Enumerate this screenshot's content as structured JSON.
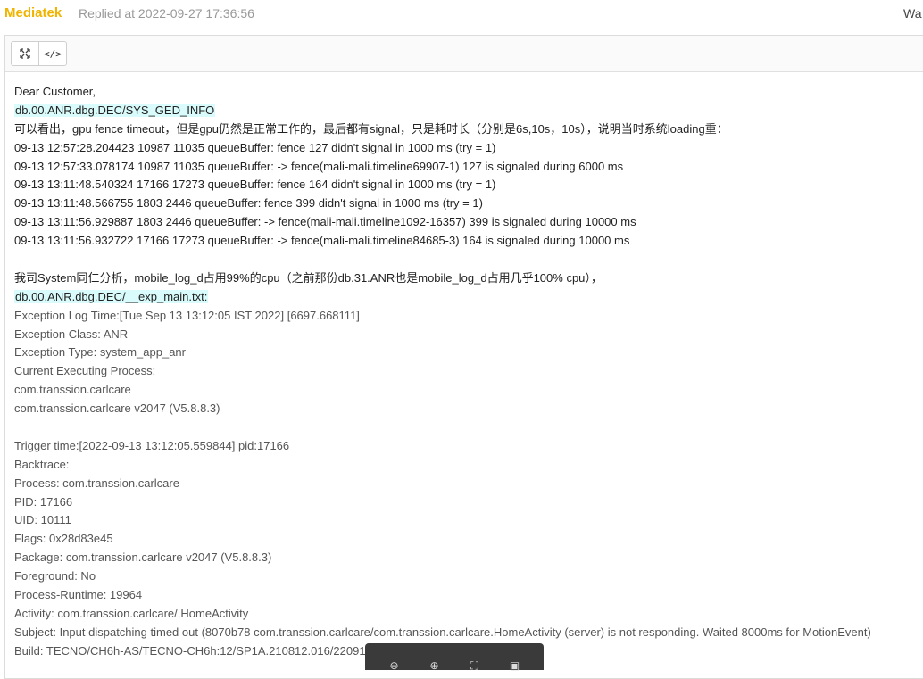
{
  "header": {
    "author": "Mediatek",
    "replied": "Replied at 2022-09-27 17:36:56",
    "right_text": "Wa"
  },
  "toolbar": {
    "fullscreen_icon": "fullscreen-icon",
    "code_label": "</>"
  },
  "lines": [
    {
      "text": "Dear Customer,",
      "hl": false,
      "gray": false
    },
    {
      "text": "db.00.ANR.dbg.DEC/SYS_GED_INFO",
      "hl": true,
      "gray": false
    },
    {
      "text": "可以看出，gpu fence timeout，但是gpu仍然是正常工作的，最后都有signal，只是耗时长（分别是6s,10s，10s），说明当时系统loading重：",
      "hl": false,
      "gray": false
    },
    {
      "text": "09-13 12:57:28.204423 10987 11035 queueBuffer: fence 127 didn't signal in 1000 ms (try = 1)",
      "hl": false,
      "gray": false
    },
    {
      "text": "09-13 12:57:33.078174 10987 11035 queueBuffer: -> fence(mali-mali.timeline69907-1) 127 is signaled during 6000 ms",
      "hl": false,
      "gray": false
    },
    {
      "text": "09-13 13:11:48.540324 17166 17273 queueBuffer: fence 164 didn't signal in 1000 ms (try = 1)",
      "hl": false,
      "gray": false
    },
    {
      "text": "09-13 13:11:48.566755  1803  2446 queueBuffer: fence 399 didn't signal in 1000 ms (try = 1)",
      "hl": false,
      "gray": false
    },
    {
      "text": "09-13 13:11:56.929887  1803  2446 queueBuffer: -> fence(mali-mali.timeline1092-16357) 399 is signaled during 10000 ms",
      "hl": false,
      "gray": false
    },
    {
      "text": "09-13 13:11:56.932722 17166 17273 queueBuffer: -> fence(mali-mali.timeline84685-3) 164 is signaled during 10000 ms",
      "hl": false,
      "gray": false
    },
    {
      "text": "",
      "hl": false,
      "gray": false
    },
    {
      "text": "我司System同仁分析，mobile_log_d占用99%的cpu（之前那份db.31.ANR也是mobile_log_d占用几乎100% cpu），",
      "hl": false,
      "gray": false
    },
    {
      "text": "db.00.ANR.dbg.DEC/__exp_main.txt:",
      "hl": true,
      "gray": false
    },
    {
      "text": "Exception Log Time:[Tue Sep 13 13:12:05 IST 2022] [6697.668111]",
      "hl": false,
      "gray": true
    },
    {
      "text": "Exception Class: ANR",
      "hl": false,
      "gray": true
    },
    {
      "text": "Exception Type: system_app_anr",
      "hl": false,
      "gray": true
    },
    {
      "text": "Current Executing Process:",
      "hl": false,
      "gray": true
    },
    {
      "text": "com.transsion.carlcare",
      "hl": false,
      "gray": true
    },
    {
      "text": "com.transsion.carlcare v2047 (V5.8.8.3)",
      "hl": false,
      "gray": true
    },
    {
      "text": "",
      "hl": false,
      "gray": true
    },
    {
      "text": "Trigger time:[2022-09-13 13:12:05.559844] pid:17166",
      "hl": false,
      "gray": true
    },
    {
      "text": "Backtrace:",
      "hl": false,
      "gray": true
    },
    {
      "text": "Process: com.transsion.carlcare",
      "hl": false,
      "gray": true
    },
    {
      "text": "PID: 17166",
      "hl": false,
      "gray": true
    },
    {
      "text": "UID: 10111",
      "hl": false,
      "gray": true
    },
    {
      "text": "Flags: 0x28d83e45",
      "hl": false,
      "gray": true
    },
    {
      "text": "Package: com.transsion.carlcare v2047 (V5.8.8.3)",
      "hl": false,
      "gray": true
    },
    {
      "text": "Foreground: No",
      "hl": false,
      "gray": true
    },
    {
      "text": "Process-Runtime: 19964",
      "hl": false,
      "gray": true
    },
    {
      "text": "Activity: com.transsion.carlcare/.HomeActivity",
      "hl": false,
      "gray": true
    },
    {
      "text": "Subject: Input dispatching timed out (8070b78 com.transsion.carlcare/com.transsion.carlcare.HomeActivity (server) is not responding. Waited 8000ms for MotionEvent)",
      "hl": false,
      "gray": true
    },
    {
      "text": "Build: TECNO/CH6h-AS/TECNO-CH6h:12/SP1A.210812.016/22091",
      "hl": false,
      "gray": true
    }
  ],
  "float_bar": {
    "icons": [
      "zoom-out-icon",
      "zoom-in-icon",
      "fit-icon",
      "save-icon"
    ]
  }
}
